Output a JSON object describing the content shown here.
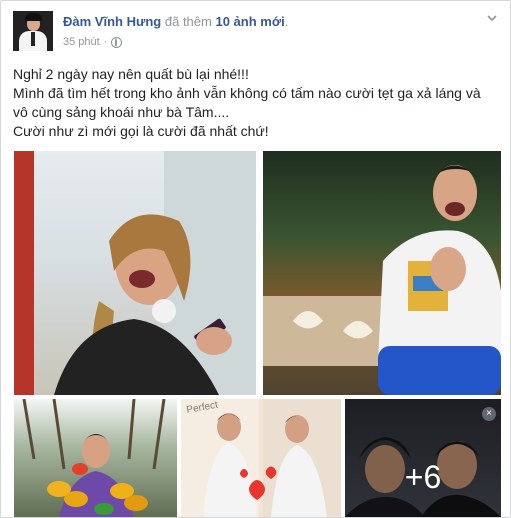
{
  "post": {
    "author": "Đàm Vĩnh Hưng",
    "action_text": "đã thêm",
    "added_count": "10 ảnh mới",
    "action_end": ".",
    "time": "35 phút",
    "separator": "·",
    "privacy_icon": "globe-icon",
    "menu_icon": "chevron-down-icon",
    "body": [
      "Nghỉ 2 ngày nay nên quất bù lại nhé!!!",
      "Mình đã tìm hết trong kho ảnh vẫn không có tấm nào cười tẹt ga xả láng và vô cùng sảng khoái như bà Tâm....",
      "Cười như zì mới gọi là cười đã nhất chứ!"
    ]
  },
  "photos": {
    "more_count": "+6",
    "photo4_sign": "Perfect",
    "photo5_close": "×"
  },
  "colors": {
    "link": "#365899",
    "meta": "#90949c",
    "text": "#1d2129"
  }
}
